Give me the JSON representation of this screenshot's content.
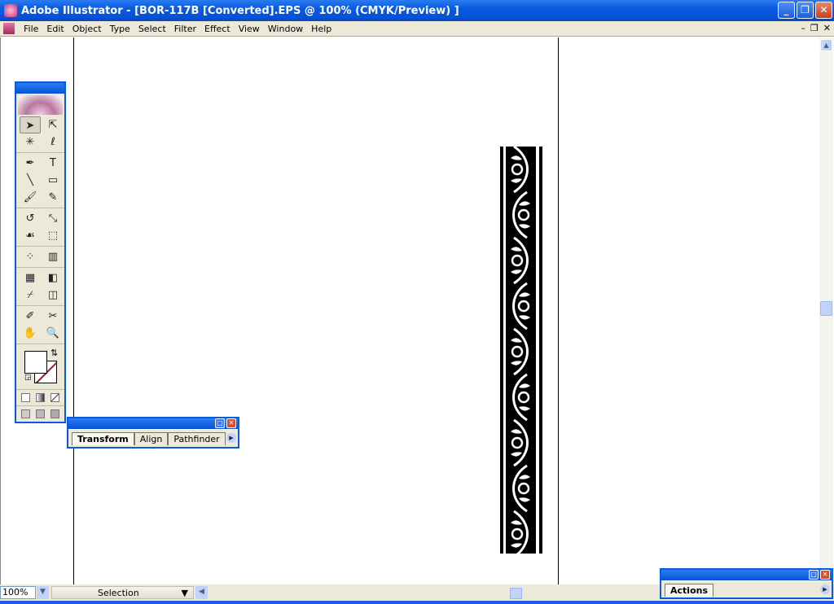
{
  "window": {
    "title": "Adobe Illustrator - [BOR-117B [Converted].EPS @ 100% (CMYK/Preview) ]"
  },
  "menu": [
    "File",
    "Edit",
    "Object",
    "Type",
    "Select",
    "Filter",
    "Effect",
    "View",
    "Window",
    "Help"
  ],
  "status": {
    "zoom": "100%",
    "tool": "Selection"
  },
  "toolbox": {
    "tools": [
      {
        "name": "selection-tool",
        "glyph": "➤"
      },
      {
        "name": "direct-selection-tool",
        "glyph": "⇱"
      },
      {
        "name": "magic-wand-tool",
        "glyph": "✳"
      },
      {
        "name": "lasso-tool",
        "glyph": "ℓ"
      },
      {
        "name": "pen-tool",
        "glyph": "✒"
      },
      {
        "name": "type-tool",
        "glyph": "T"
      },
      {
        "name": "line-tool",
        "glyph": "╲"
      },
      {
        "name": "rectangle-tool",
        "glyph": "▭"
      },
      {
        "name": "paintbrush-tool",
        "glyph": "🖌"
      },
      {
        "name": "pencil-tool",
        "glyph": "✎"
      },
      {
        "name": "rotate-tool",
        "glyph": "↺"
      },
      {
        "name": "scale-tool",
        "glyph": "⤡"
      },
      {
        "name": "warp-tool",
        "glyph": "☙"
      },
      {
        "name": "free-transform-tool",
        "glyph": "⬚"
      },
      {
        "name": "symbol-sprayer-tool",
        "glyph": "⁘"
      },
      {
        "name": "graph-tool",
        "glyph": "▥"
      },
      {
        "name": "mesh-tool",
        "glyph": "▦"
      },
      {
        "name": "gradient-tool",
        "glyph": "◧"
      },
      {
        "name": "eyedropper-tool",
        "glyph": "⌿"
      },
      {
        "name": "blend-tool",
        "glyph": "◫"
      },
      {
        "name": "slice-tool",
        "glyph": "✐"
      },
      {
        "name": "scissors-tool",
        "glyph": "✂"
      },
      {
        "name": "hand-tool",
        "glyph": "✋"
      },
      {
        "name": "zoom-tool",
        "glyph": "🔍"
      }
    ]
  },
  "panels": {
    "transform_group": {
      "tabs": [
        "Transform",
        "Align",
        "Pathfinder"
      ]
    },
    "actions": {
      "tabs": [
        "Actions"
      ]
    }
  },
  "colors": {
    "titlebar": "#0a5ae0",
    "chrome": "#ece9d8",
    "stroke_none": "#a0123a"
  }
}
